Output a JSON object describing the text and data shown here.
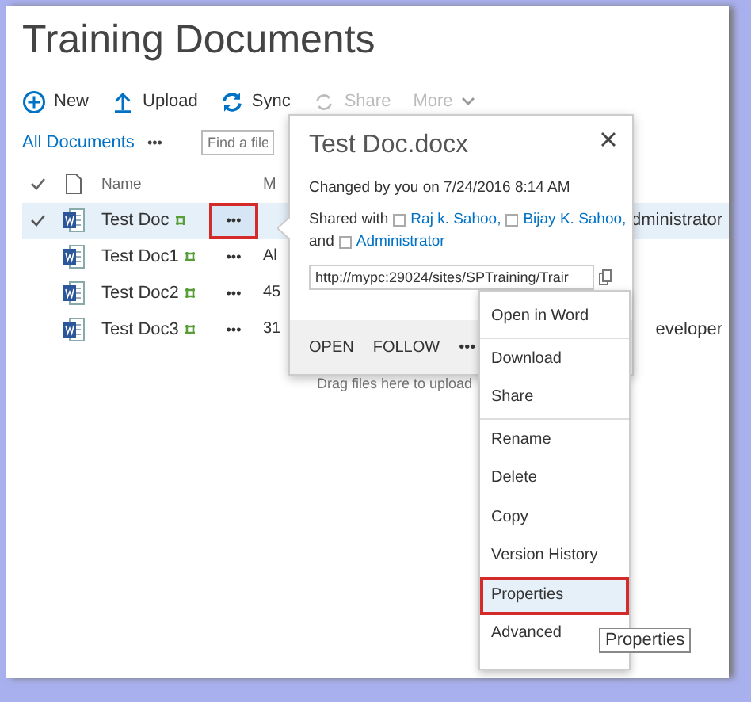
{
  "page": {
    "title": "Training Documents"
  },
  "toolbar": [
    {
      "label": "New",
      "disabled": false
    },
    {
      "label": "Upload",
      "disabled": false
    },
    {
      "label": "Sync",
      "disabled": false
    },
    {
      "label": "Share",
      "disabled": true
    },
    {
      "label": "More",
      "disabled": true
    }
  ],
  "views": {
    "current": "All Documents",
    "more": "•••",
    "search": {
      "placeholder": "Find a file"
    }
  },
  "list": {
    "columns": [
      {
        "label": "Name"
      },
      {
        "label": "M"
      }
    ],
    "rows": [
      {
        "name": "Test Doc",
        "selected": true,
        "menu": "•••",
        "menu_annotated": true,
        "column_3": "dministrator"
      },
      {
        "name": "Test Doc1",
        "selected": false,
        "menu": "•••",
        "menu_annotated": false,
        "column_2": "Al"
      },
      {
        "name": "Test Doc2",
        "selected": false,
        "menu": "•••",
        "menu_annotated": false,
        "column_2": "45"
      },
      {
        "name": "Test Doc3",
        "selected": false,
        "menu": "•••",
        "menu_annotated": false,
        "column_2": "31",
        "column_3": "eveloper"
      }
    ],
    "drop_hint": "Drag files here to upload"
  },
  "callout": {
    "title": "Test Doc.docx",
    "changed": "Changed by you on 7/24/2016 8:14 AM",
    "shared_prefix": "Shared with",
    "people": [
      "Raj k. Sahoo,",
      "Bijay K. Sahoo,",
      "Administrator"
    ],
    "conjunction": "and",
    "url": "http://mypc:29024/sites/SPTraining/Trair",
    "actions": [
      "OPEN",
      "FOLLOW",
      "•••"
    ]
  },
  "menu": {
    "items": [
      {
        "label": "Open in Word",
        "selected": false,
        "divider_after": true
      },
      {
        "label": "Download",
        "selected": false,
        "divider_after": false
      },
      {
        "label": "Share",
        "selected": false,
        "divider_after": true
      },
      {
        "label": "Rename",
        "selected": false,
        "divider_after": false
      },
      {
        "label": "Delete",
        "selected": false,
        "divider_after": false
      },
      {
        "label": "Copy",
        "selected": false,
        "divider_after": false
      },
      {
        "label": "Version History",
        "selected": false,
        "divider_after": false
      },
      {
        "label": "Properties",
        "selected": true,
        "divider_after": false
      },
      {
        "label": "Advanced",
        "selected": false,
        "divider_after": false
      }
    ]
  },
  "tooltip": "Properties"
}
